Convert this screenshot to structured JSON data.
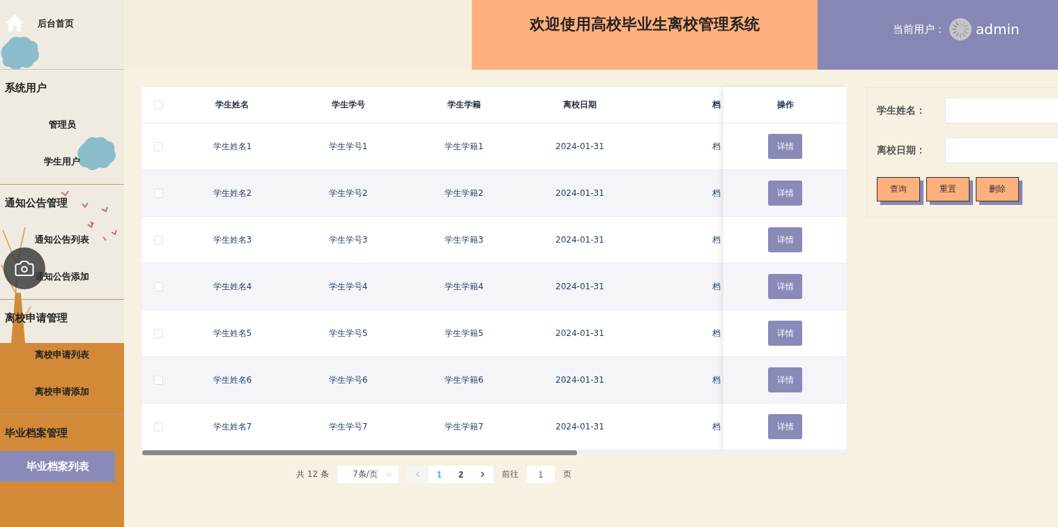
{
  "sidebar": {
    "home": {
      "label": "后台首页"
    },
    "groups": [
      {
        "title": "系统用户",
        "items": [
          {
            "label": "管理员",
            "selected": false
          },
          {
            "label": "学生用户",
            "selected": false
          }
        ]
      },
      {
        "title": "通知公告管理",
        "items": [
          {
            "label": "通知公告列表",
            "selected": false
          },
          {
            "label": "通知公告添加",
            "selected": false
          }
        ]
      },
      {
        "title": "离校申请管理",
        "items": [
          {
            "label": "离校申请列表",
            "selected": false
          },
          {
            "label": "离校申请添加",
            "selected": false
          }
        ]
      },
      {
        "title": "毕业档案管理",
        "items": [
          {
            "label": "毕业档案列表",
            "selected": true
          }
        ]
      }
    ]
  },
  "header": {
    "title": "欢迎使用高校毕业生离校管理系统",
    "user_label": "当前用户：",
    "username": "admin"
  },
  "table": {
    "select_all_checked": false,
    "columns": [
      "学生姓名",
      "学生学号",
      "学生学籍",
      "离校日期",
      "档"
    ],
    "action_column": "操作",
    "rows": [
      {
        "checked": false,
        "cells": [
          "学生姓名1",
          "学生学号1",
          "学生学籍1",
          "2024-01-31",
          "档"
        ],
        "action": "详情"
      },
      {
        "checked": false,
        "cells": [
          "学生姓名2",
          "学生学号2",
          "学生学籍2",
          "2024-01-31",
          "档"
        ],
        "action": "详情"
      },
      {
        "checked": false,
        "cells": [
          "学生姓名3",
          "学生学号3",
          "学生学籍3",
          "2024-01-31",
          "档"
        ],
        "action": "详情"
      },
      {
        "checked": false,
        "cells": [
          "学生姓名4",
          "学生学号4",
          "学生学籍4",
          "2024-01-31",
          "档"
        ],
        "action": "详情"
      },
      {
        "checked": false,
        "cells": [
          "学生姓名5",
          "学生学号5",
          "学生学籍5",
          "2024-01-31",
          "档"
        ],
        "action": "详情"
      },
      {
        "checked": false,
        "cells": [
          "学生姓名6",
          "学生学号6",
          "学生学籍6",
          "2024-01-31",
          "档"
        ],
        "action": "详情"
      },
      {
        "checked": false,
        "cells": [
          "学生姓名7",
          "学生学号7",
          "学生学籍7",
          "2024-01-31",
          "档"
        ],
        "action": "详情"
      }
    ]
  },
  "pagination": {
    "total": "共 12 条",
    "page_size": "7条/页",
    "pages": [
      {
        "label": "1",
        "selected": true
      },
      {
        "label": "2",
        "selected": false
      }
    ],
    "goto_label": "前往",
    "goto_value": "1",
    "goto_suffix": "页"
  },
  "search": {
    "fields": [
      {
        "label": "学生姓名："
      },
      {
        "label": "离校日期："
      }
    ],
    "buttons": [
      "查询",
      "重置",
      "删除"
    ]
  }
}
